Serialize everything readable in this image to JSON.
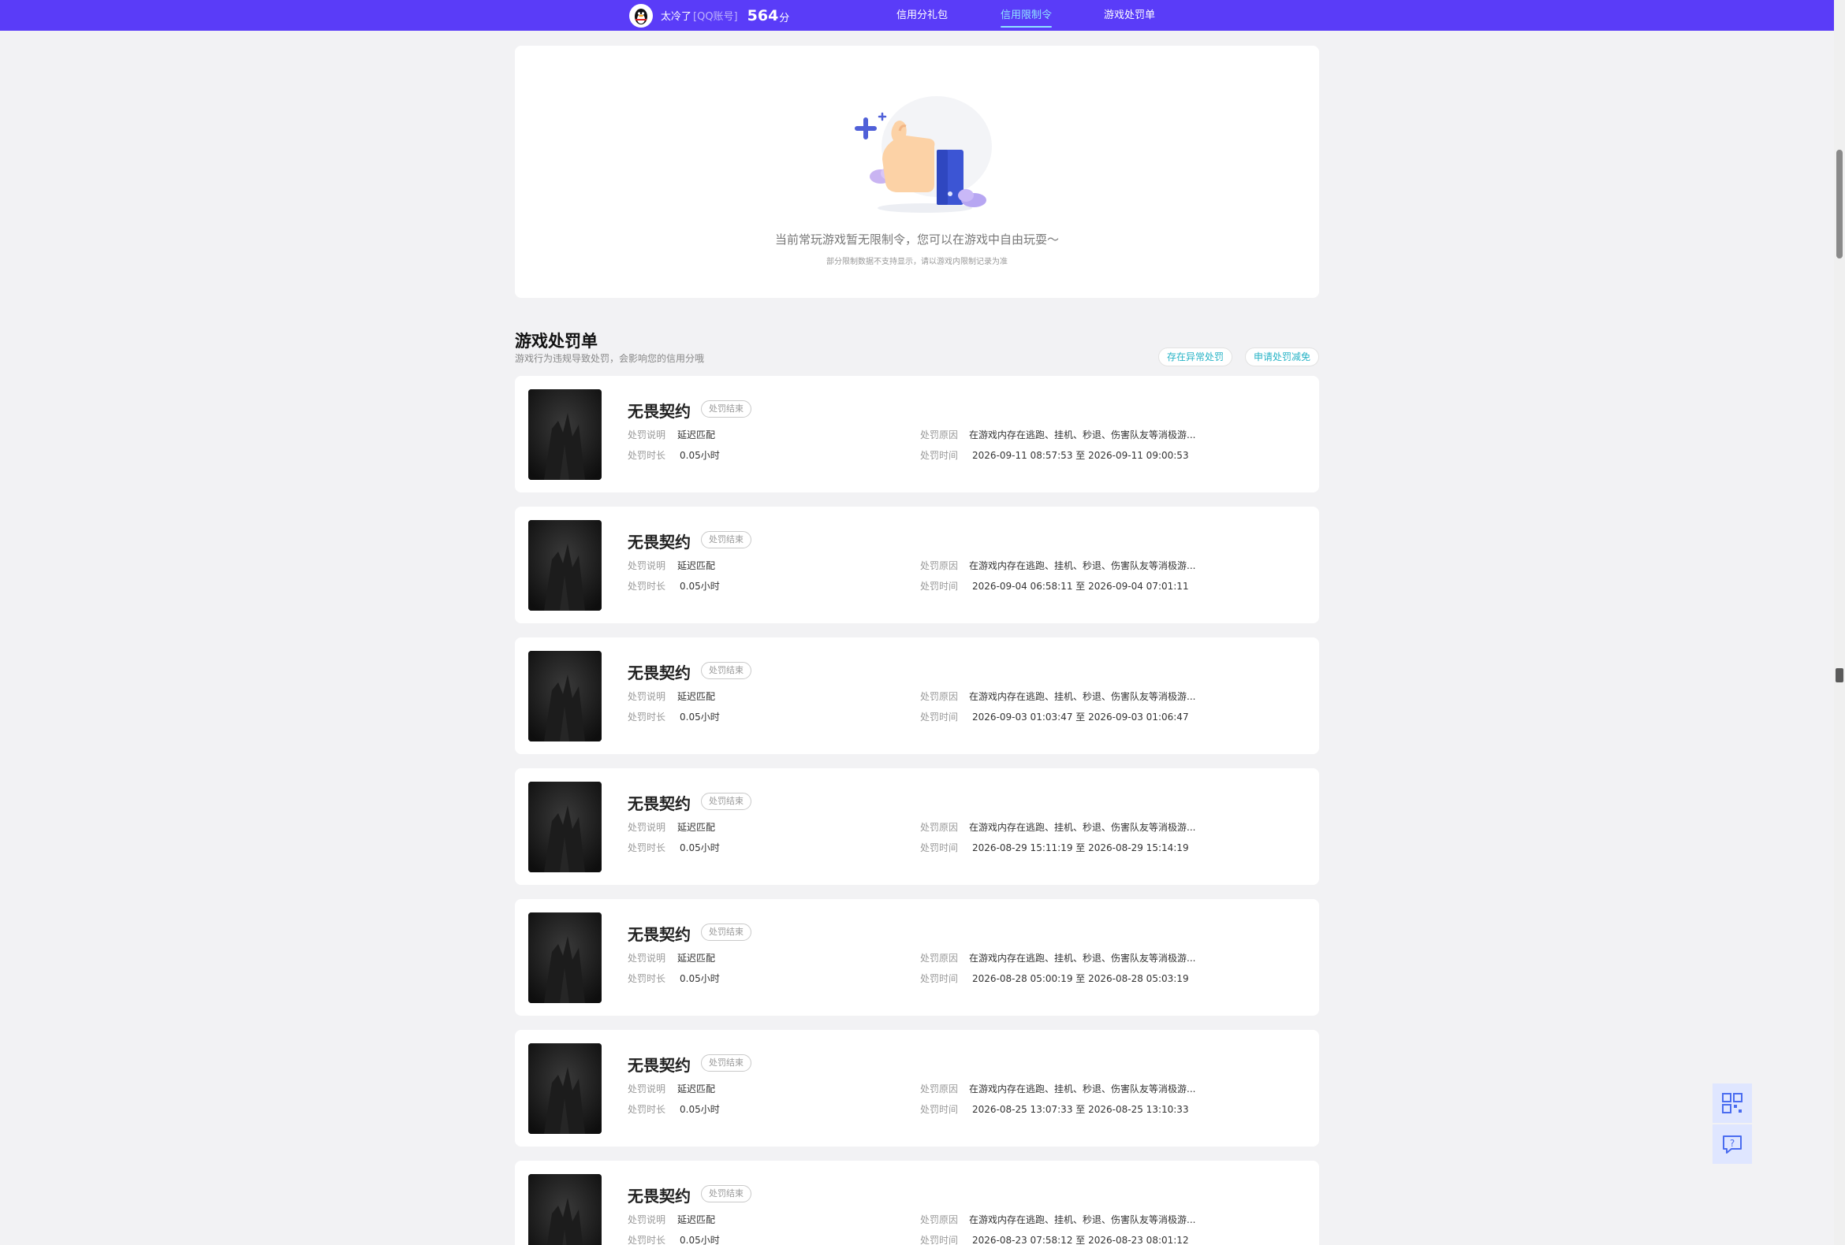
{
  "header": {
    "user_name": "太冷了",
    "account_type": "[QQ账号]",
    "credit_score": "564",
    "score_unit": "分",
    "tabs": [
      {
        "label": "信用分礼包"
      },
      {
        "label": "信用限制令"
      },
      {
        "label": "游戏处罚单"
      }
    ],
    "active_tab": "信用限制令"
  },
  "restriction": {
    "main_text": "当前常玩游戏暂无限制令，您可以在游戏中自由玩耍～",
    "sub_text": "部分限制数据不支持显示，请以游戏内限制记录为准"
  },
  "punish": {
    "title": "游戏处罚单",
    "subtitle": "游戏行为违规导致处罚，会影响您的信用分哦",
    "buttons": {
      "abnormal": "存在异常处罚",
      "appeal": "申请处罚减免"
    },
    "labels": {
      "desc": "处罚说明",
      "duration": "处罚时长",
      "reason": "处罚原因",
      "time": "处罚时间",
      "separator": "至"
    },
    "items": [
      {
        "game": "无畏契约",
        "status": "处罚结束",
        "desc": "延迟匹配",
        "duration": "0.05小时",
        "reason": "在游戏内存在逃跑、挂机、秒退、伤害队友等消极游...",
        "start": "2026-09-11 08:57:53",
        "end": "2026-09-11 09:00:53"
      },
      {
        "game": "无畏契约",
        "status": "处罚结束",
        "desc": "延迟匹配",
        "duration": "0.05小时",
        "reason": "在游戏内存在逃跑、挂机、秒退、伤害队友等消极游...",
        "start": "2026-09-04 06:58:11",
        "end": "2026-09-04 07:01:11"
      },
      {
        "game": "无畏契约",
        "status": "处罚结束",
        "desc": "延迟匹配",
        "duration": "0.05小时",
        "reason": "在游戏内存在逃跑、挂机、秒退、伤害队友等消极游...",
        "start": "2026-09-03 01:03:47",
        "end": "2026-09-03 01:06:47"
      },
      {
        "game": "无畏契约",
        "status": "处罚结束",
        "desc": "延迟匹配",
        "duration": "0.05小时",
        "reason": "在游戏内存在逃跑、挂机、秒退、伤害队友等消极游...",
        "start": "2026-08-29 15:11:19",
        "end": "2026-08-29 15:14:19"
      },
      {
        "game": "无畏契约",
        "status": "处罚结束",
        "desc": "延迟匹配",
        "duration": "0.05小时",
        "reason": "在游戏内存在逃跑、挂机、秒退、伤害队友等消极游...",
        "start": "2026-08-28 05:00:19",
        "end": "2026-08-28 05:03:19"
      },
      {
        "game": "无畏契约",
        "status": "处罚结束",
        "desc": "延迟匹配",
        "duration": "0.05小时",
        "reason": "在游戏内存在逃跑、挂机、秒退、伤害队友等消极游...",
        "start": "2026-08-25 13:07:33",
        "end": "2026-08-25 13:10:33"
      },
      {
        "game": "无畏契约",
        "status": "处罚结束",
        "desc": "延迟匹配",
        "duration": "0.05小时",
        "reason": "在游戏内存在逃跑、挂机、秒退、伤害队友等消极游...",
        "start": "2026-08-23 07:58:12",
        "end": "2026-08-23 08:01:12"
      }
    ]
  },
  "icons": {
    "avatar": "qq-penguin-icon",
    "illustration": "thumbs-up-illustration",
    "float_top": "qr-code-icon",
    "float_bottom": "feedback-question-icon"
  },
  "colors": {
    "header_bg": "#5a3cf8",
    "active_tab": "#8fe3ff",
    "link_accent": "#26b3c6"
  }
}
